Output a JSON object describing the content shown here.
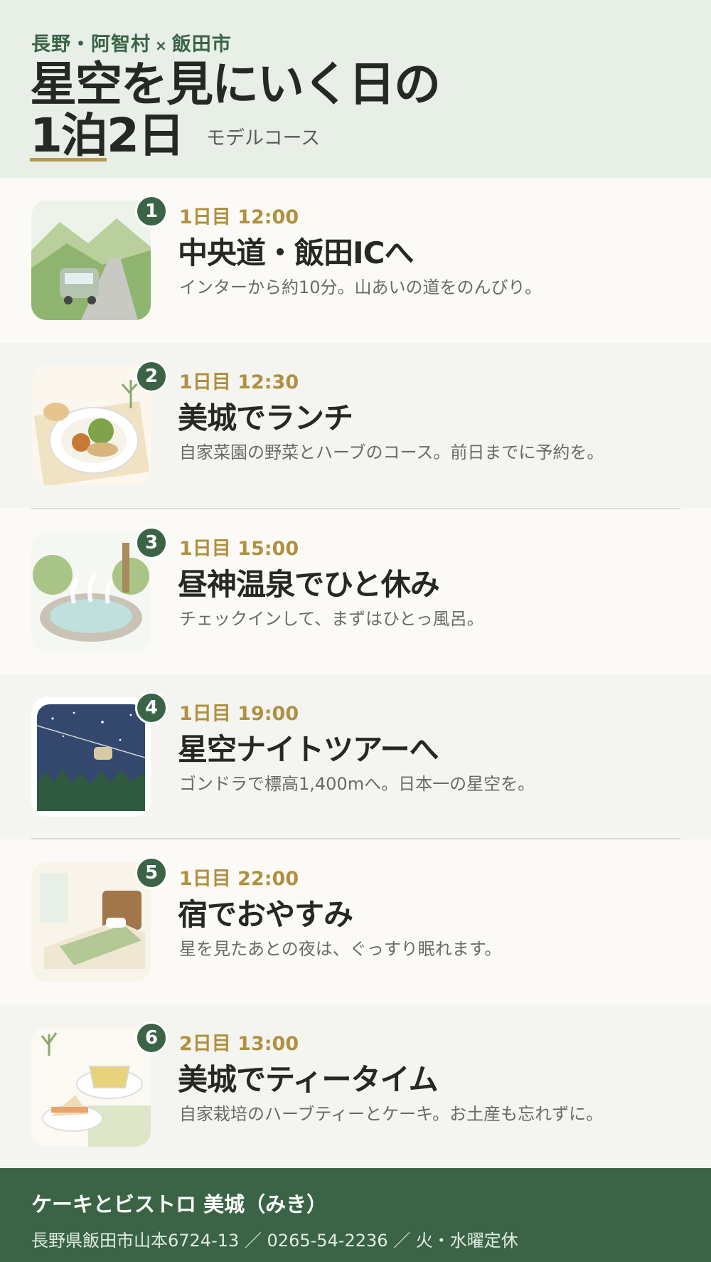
{
  "header": {
    "region": "長野・阿智村",
    "cross": "×",
    "city": "飯田市",
    "title_line1": "星空を見にいく日の",
    "title_nights": "1泊",
    "title_days": "2日",
    "subtitle": "モデルコース"
  },
  "steps": [
    {
      "number": "1",
      "time": "1日目 12:00",
      "name": "中央道・飯田ICへ",
      "desc": "インターから約10分。山あいの道をのんびり。",
      "image": "car-road-icon"
    },
    {
      "number": "2",
      "time": "1日目 12:30",
      "name": "美城でランチ",
      "desc": "自家菜園の野菜とハーブのコース。前日までに予約を。",
      "image": "lunch-plate-icon"
    },
    {
      "number": "3",
      "time": "1日目 15:00",
      "name": "昼神温泉でひと休み",
      "desc": "チェックインして、まずはひとっ風呂。",
      "image": "hot-spring-icon"
    },
    {
      "number": "4",
      "time": "1日目 19:00",
      "name": "星空ナイトツアーへ",
      "desc": "ゴンドラで標高1,400mへ。日本一の星空を。",
      "image": "starry-gondola-icon"
    },
    {
      "number": "5",
      "time": "1日目 22:00",
      "name": "宿でおやすみ",
      "desc": "星を見たあとの夜は、ぐっすり眠れます。",
      "image": "bed-icon"
    },
    {
      "number": "6",
      "time": "2日目 13:00",
      "name": "美城でティータイム",
      "desc": "自家栽培のハーブティーとケーキ。お土産も忘れずに。",
      "image": "tea-cake-icon"
    }
  ],
  "footer": {
    "shop": "ケーキとビストロ 美城（みき）",
    "info": "長野県飯田市山本6724-13 ／ 0265-54-2236 ／ 火・水曜定休"
  },
  "colors": {
    "accent_green": "#3b6447",
    "accent_gold": "#b09040",
    "header_bg": "#e7efe6"
  }
}
